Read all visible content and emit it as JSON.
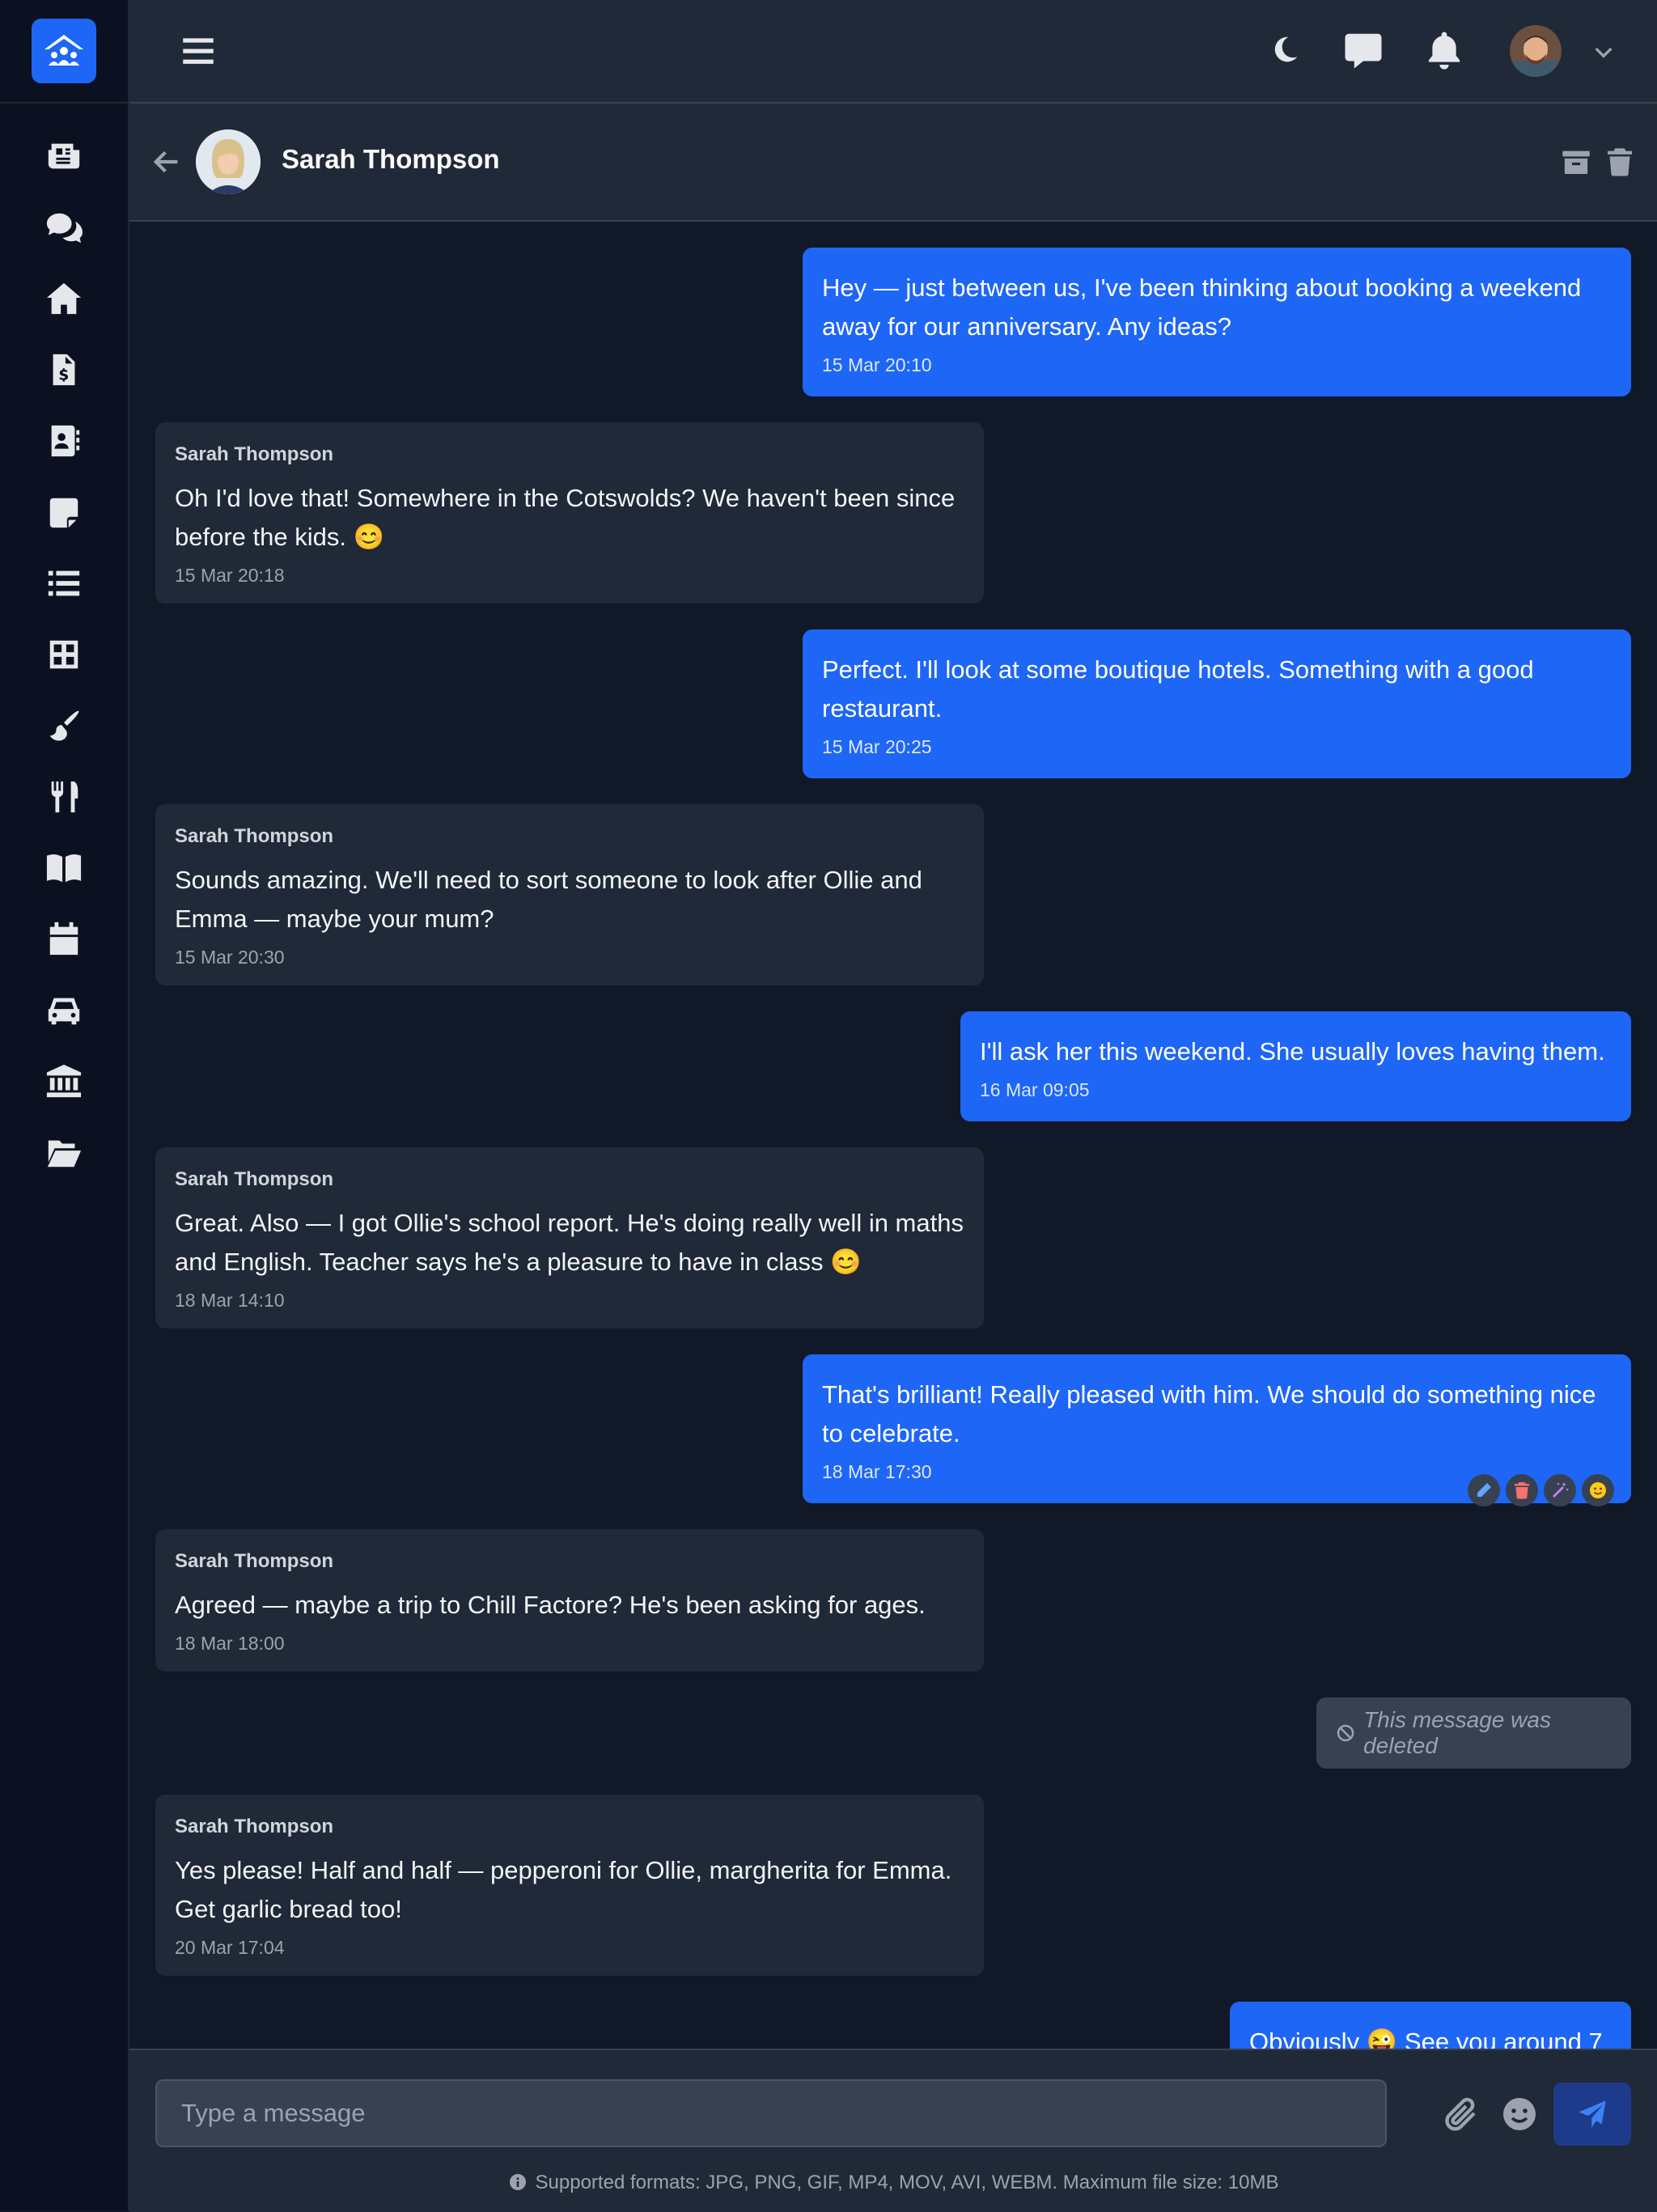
{
  "sidebar": {
    "items": [
      {
        "icon": "newspaper-icon"
      },
      {
        "icon": "comments-icon"
      },
      {
        "icon": "home-icon"
      },
      {
        "icon": "invoice-icon"
      },
      {
        "icon": "contact-card-icon"
      },
      {
        "icon": "sticky-note-icon"
      },
      {
        "icon": "list-icon"
      },
      {
        "icon": "grid-icon"
      },
      {
        "icon": "paintbrush-icon"
      },
      {
        "icon": "utensils-icon"
      },
      {
        "icon": "book-icon"
      },
      {
        "icon": "calendar-icon"
      },
      {
        "icon": "car-icon"
      },
      {
        "icon": "bank-icon"
      },
      {
        "icon": "folder-open-icon"
      }
    ]
  },
  "chat": {
    "contact_name": "Sarah Thompson",
    "messages": [
      {
        "direction": "out",
        "text": "Hey — just between us, I've been thinking about booking a weekend away for our anniversary. Any ideas?",
        "time": "15 Mar 20:10"
      },
      {
        "direction": "in",
        "sender": "Sarah Thompson",
        "text": "Oh I'd love that! Somewhere in the Cotswolds? We haven't been since before the kids. 😊",
        "time": "15 Mar 20:18"
      },
      {
        "direction": "out",
        "text": "Perfect. I'll look at some boutique hotels. Something with a good restaurant.",
        "time": "15 Mar 20:25"
      },
      {
        "direction": "in",
        "sender": "Sarah Thompson",
        "text": "Sounds amazing. We'll need to sort someone to look after Ollie and Emma — maybe your mum?",
        "time": "15 Mar 20:30"
      },
      {
        "direction": "out",
        "text": "I'll ask her this weekend. She usually loves having them.",
        "time": "16 Mar 09:05"
      },
      {
        "direction": "in",
        "sender": "Sarah Thompson",
        "text": "Great. Also — I got Ollie's school report. He's doing really well in maths and English. Teacher says he's a pleasure to have in class 😊",
        "time": "18 Mar 14:10"
      },
      {
        "direction": "out",
        "text": "That's brilliant! Really pleased with him. We should do something nice to celebrate.",
        "time": "18 Mar 17:30"
      },
      {
        "direction": "in",
        "sender": "Sarah Thompson",
        "text": "Agreed — maybe a trip to Chill Factore? He's been asking for ages.",
        "time": "18 Mar 18:00"
      },
      {
        "direction": "out",
        "deleted_text": "This message was deleted"
      },
      {
        "direction": "in",
        "sender": "Sarah Thompson",
        "text": "Yes please! Half and half — pepperoni for Ollie, margherita for Emma. Get garlic bread too!",
        "time": "20 Mar 17:04"
      },
      {
        "direction": "out",
        "text": "Obviously 😜 See you around 7",
        "time": ""
      }
    ],
    "hover_actions": [
      "edit-icon",
      "delete-icon",
      "magic-wand-icon",
      "emoji-icon"
    ]
  },
  "composer": {
    "placeholder": "Type a message",
    "hint": "Supported formats: JPG, PNG, GIF, MP4, MOV, AVI, WEBM. Maximum file size: 10MB"
  },
  "colors": {
    "accent": "#1e66f5",
    "background": "#111827",
    "panel": "#1f2937",
    "sidebar": "#0b1120"
  }
}
